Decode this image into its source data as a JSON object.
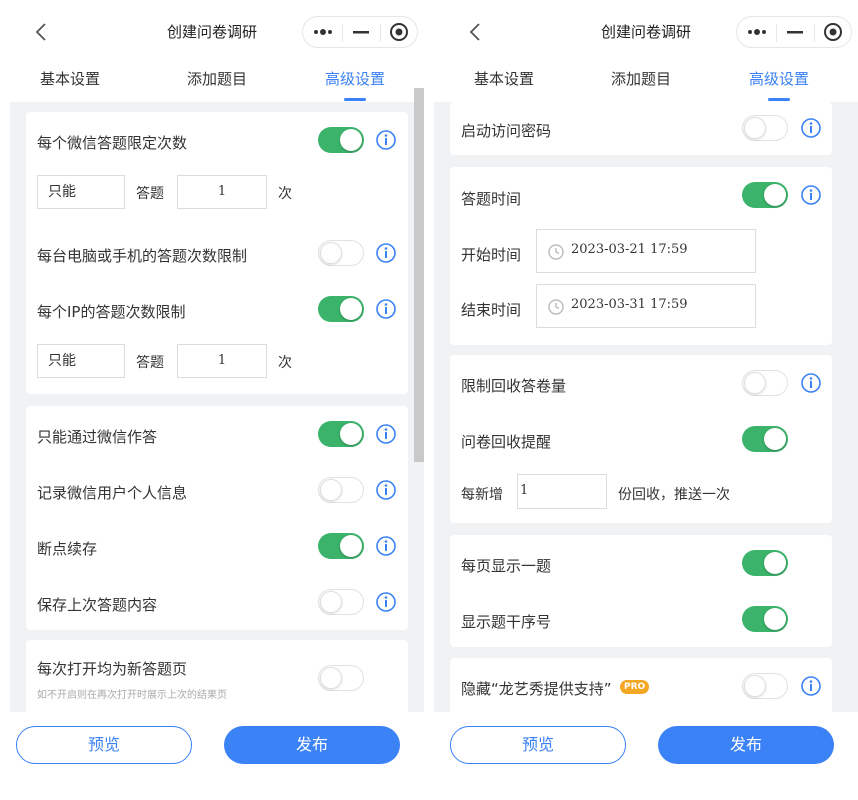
{
  "header": {
    "title": "创建问卷调研"
  },
  "tabs": [
    "基本设置",
    "添加题目",
    "高级设置"
  ],
  "left": {
    "limit_times": {
      "label": "每个微信答题限定次数",
      "only": "只能",
      "answer": "答题",
      "count": "1",
      "unit": "次"
    },
    "device_limit": {
      "label": "每台电脑或手机的答题次数限制"
    },
    "ip_limit": {
      "label": "每个IP的答题次数限制",
      "only": "只能",
      "answer": "答题",
      "count": "1",
      "unit": "次"
    },
    "wechat_only": {
      "label": "只能通过微信作答"
    },
    "record_info": {
      "label": "记录微信用户个人信息"
    },
    "resume": {
      "label": "断点续存"
    },
    "save_last": {
      "label": "保存上次答题内容"
    },
    "new_page": {
      "label": "每次打开均为新答题页",
      "hint": "如不开启则在再次打开时展示上次的结果页"
    }
  },
  "right": {
    "password": {
      "label": "启动访问密码"
    },
    "answer_time": {
      "label": "答题时间",
      "start_label": "开始时间",
      "start_value": "2023-03-21 17:59",
      "end_label": "结束时间",
      "end_value": "2023-03-31 17:59"
    },
    "limit_recycle": {
      "label": "限制回收答卷量"
    },
    "recycle_remind": {
      "label": "问卷回收提醒",
      "prefix": "每新增",
      "value": "1",
      "suffix": "份回收，推送一次"
    },
    "one_per_page": {
      "label": "每页显示一题"
    },
    "show_number": {
      "label": "显示题干序号"
    },
    "hide_brand": {
      "label": "隐藏“龙艺秀提供支持”",
      "badge": "PRO"
    }
  },
  "footer": {
    "preview": "预览",
    "publish": "发布"
  },
  "colors": {
    "accent": "#3b82f6",
    "toggle_on": "#3bb36a",
    "pro": "#f5a623"
  }
}
